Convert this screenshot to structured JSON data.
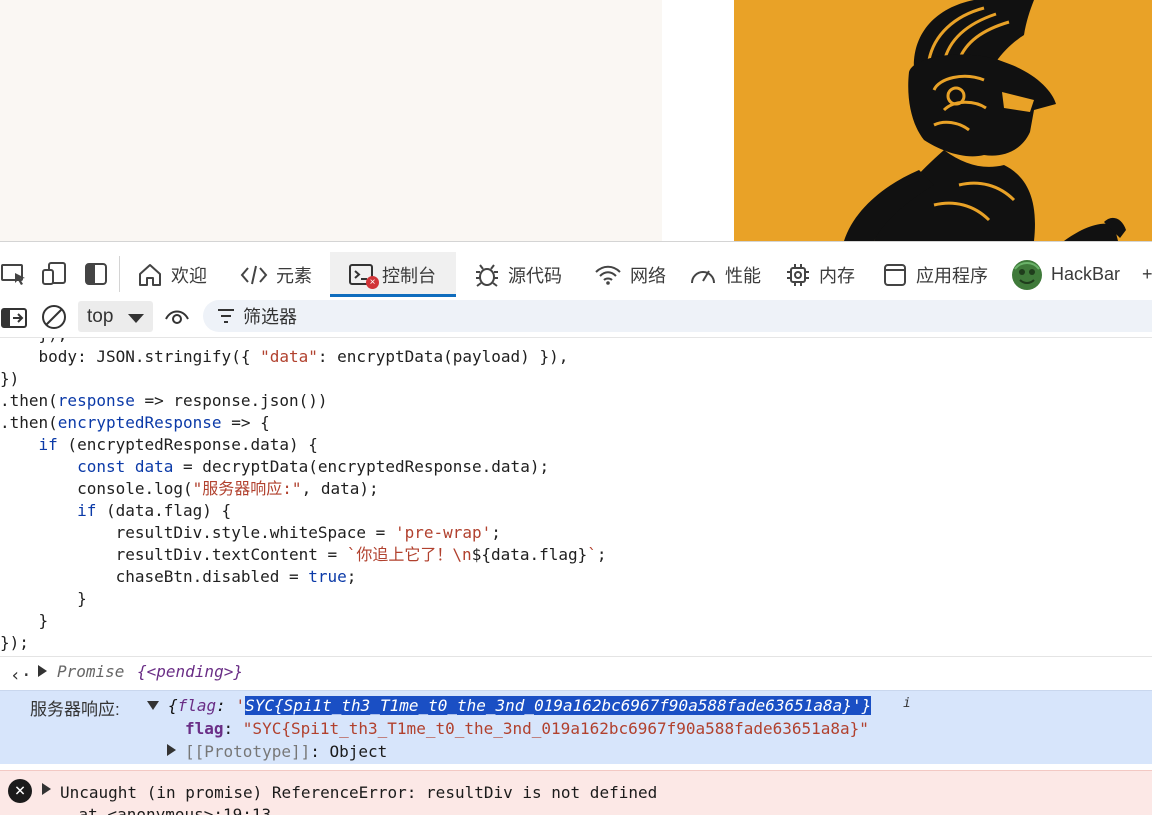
{
  "tabs": {
    "welcome": "欢迎",
    "elements": "元素",
    "console": "控制台",
    "sources": "源代码",
    "network": "网络",
    "performance": "性能",
    "memory": "内存",
    "application": "应用程序",
    "hackbar": "HackBar",
    "more": "+"
  },
  "toolbar": {
    "context": "top",
    "filter_label": "筛选器"
  },
  "code": {
    "l0": "    }),",
    "l1": "    body: JSON.stringify({ ",
    "l1_str": "\"data\"",
    "l1_rest": ": encryptData(payload) }),",
    "l2": "})",
    "l3a": ".then(",
    "l3v": "response",
    "l3b": " => response.json())",
    "l4a": ".then(",
    "l4v": "encryptedResponse",
    "l4b": " => {",
    "l5k": "    if",
    "l5b": " (encryptedResponse.data) {",
    "l6k": "        const",
    "l6v": " data",
    "l6b": " = decryptData(encryptedResponse.data);",
    "l7a": "        console.log(",
    "l7s": "\"服务器响应:\"",
    "l7b": ", data);",
    "l8k": "        if",
    "l8b": " (data.flag) {",
    "l9a": "            resultDiv.style.whiteSpace = ",
    "l9s": "'pre-wrap'",
    "l9b": ";",
    "l10a": "            resultDiv.textContent = ",
    "l10s": "`你追上它了！\\n",
    "l10m": "${data.flag}",
    "l10s2": "`",
    "l10b": ";",
    "l11a": "            chaseBtn.disabled = ",
    "l11k": "true",
    "l11b": ";",
    "l12": "        }",
    "l13": "    }",
    "l14": "});"
  },
  "promise": {
    "label": "Promise",
    "state": "{<pending>}"
  },
  "log": {
    "prefix": "服务器响应:",
    "open": "{",
    "key": "flag",
    "colon": ": ",
    "quote_open": "'",
    "value_selected": "SYC{Spi1t_th3_T1me_t0_the_3nd_019a162bc6967f90a588fade63651a8a}",
    "quote_close": "'",
    "close": "}",
    "info": "i",
    "prop_key": "flag",
    "prop_colon": ": ",
    "prop_value": "\"SYC{Spi1t_th3_T1me_t0_the_3nd_019a162bc6967f90a588fade63651a8a}\"",
    "proto_key": "[[Prototype]]",
    "proto_value": ": Object"
  },
  "error": {
    "message": "Uncaught (in promise) ReferenceError: resultDiv is not defined",
    "trace": "    at <anonymous>:19:13"
  },
  "colors": {
    "accent": "#0f6cbd",
    "art_bg": "#e9a227",
    "log_bg": "#d7e5fb",
    "error_bg": "#fce8e6"
  }
}
